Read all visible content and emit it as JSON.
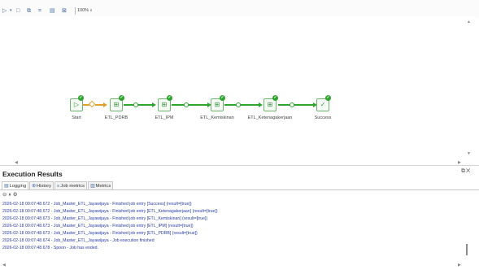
{
  "toolbar": {
    "buttons": [
      {
        "name": "run-icon",
        "glyph": "▷"
      },
      {
        "name": "run-options-icon",
        "glyph": "▾"
      },
      {
        "name": "stop-icon",
        "glyph": "□"
      },
      {
        "name": "preview-icon",
        "glyph": "⧉"
      },
      {
        "name": "debug-icon",
        "glyph": "⌗"
      },
      {
        "name": "layout-icon",
        "glyph": "▤"
      },
      {
        "name": "grid-icon",
        "glyph": "⊠"
      }
    ],
    "zoom_value": "100%"
  },
  "job": {
    "nodes": [
      {
        "id": "start",
        "label": "Start",
        "icon": "start-icon"
      },
      {
        "id": "etl-pdrb",
        "label": "ETL_PDRB",
        "icon": "transformation-icon"
      },
      {
        "id": "etl-ipm",
        "label": "ETL_IPM",
        "icon": "transformation-icon"
      },
      {
        "id": "etl-kemiskinan",
        "label": "ETL_Kemiskinan",
        "icon": "transformation-icon"
      },
      {
        "id": "etl-ketenagakerjaan",
        "label": "ETL_Ketenagakerjaan",
        "icon": "transformation-icon"
      },
      {
        "id": "success",
        "label": "Success",
        "icon": "success-icon"
      }
    ],
    "status_color": "#2fa52f"
  },
  "results": {
    "title": "Execution Results",
    "tabs": [
      {
        "label": "Logging",
        "icon": "logging-icon"
      },
      {
        "label": "History",
        "icon": "history-icon"
      },
      {
        "label": "Job metrics",
        "icon": "job-metrics-icon"
      },
      {
        "label": "Metrics",
        "icon": "metrics-icon"
      }
    ],
    "log_lines": [
      "2026-02-18 00:07:48.672 - Job_Master_ETL_Jayawijaya - Finished job entry [Success] (result=[true])",
      "2026-02-18 00:07:48.672 - Job_Master_ETL_Jayawijaya - Finished job entry [ETL_Ketenagakerjaan] (result=[true])",
      "2026-02-18 00:07:48.673 - Job_Master_ETL_Jayawijaya - Finished job entry [ETL_Kemiskinan] (result=[true])",
      "2026-02-18 00:07:48.673 - Job_Master_ETL_Jayawijaya - Finished job entry [ETL_IPM] (result=[true])",
      "2026-02-18 00:07:48.673 - Job_Master_ETL_Jayawijaya - Finished job entry [ETL_PDRB] (result=[true])",
      "2026-02-18 00:07:48.674 - Job_Master_ETL_Jayawijaya - Job execution finished",
      "2026-02-18 00:07:48.678 - Spoon - Job has ended."
    ],
    "log_color": "#2a3ca8"
  }
}
